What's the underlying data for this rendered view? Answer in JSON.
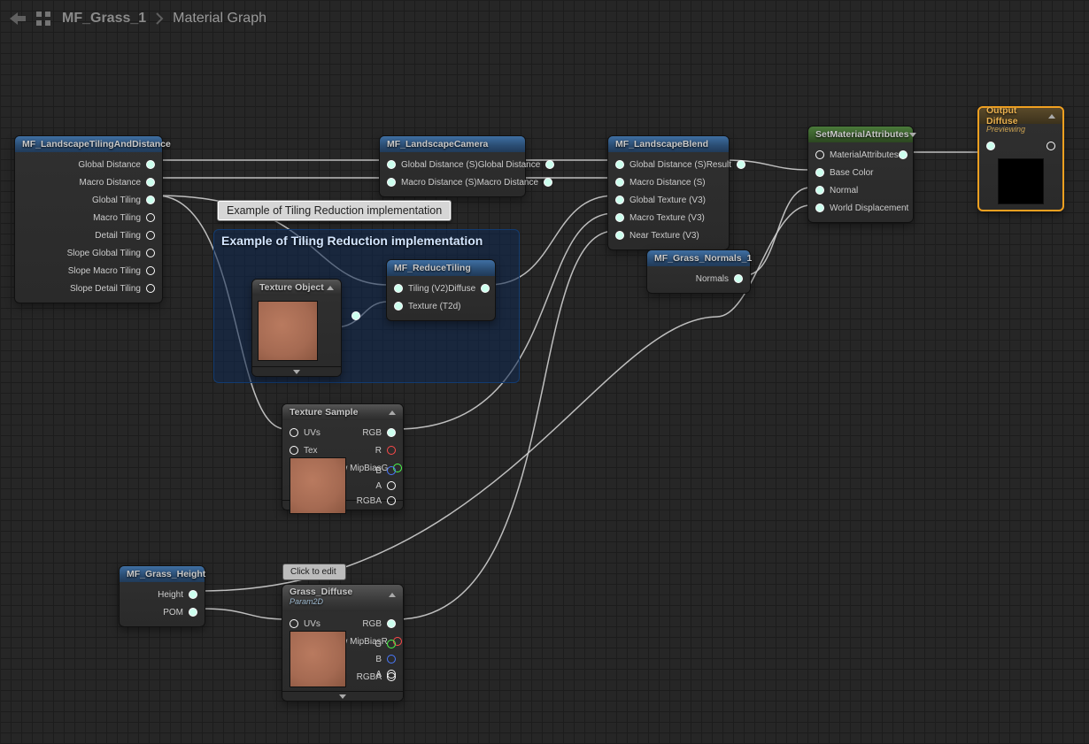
{
  "breadcrumb": {
    "asset": "MF_Grass_1",
    "page": "Material Graph"
  },
  "tooltip": "Example of Tiling Reduction implementation",
  "comment": {
    "title": "Example of Tiling Reduction implementation"
  },
  "clickToEdit": {
    "placeholder": "Click to edit"
  },
  "nodes": {
    "tilingDist": {
      "title": "MF_LandscapeTilingAndDistance",
      "outs": [
        "Global Distance",
        "Macro Distance",
        "Global Tiling",
        "Macro Tiling",
        "Detail Tiling",
        "Slope Global Tiling",
        "Slope Macro Tiling",
        "Slope Detail Tiling"
      ]
    },
    "camera": {
      "title": "MF_LandscapeCamera",
      "rows": [
        {
          "in": "Global Distance (S)",
          "out": "Global Distance"
        },
        {
          "in": "Macro Distance (S)",
          "out": "Macro Distance"
        }
      ]
    },
    "blend": {
      "title": "MF_LandscapeBlend",
      "ins": [
        "Global Distance (S)",
        "Macro Distance (S)",
        "Global Texture (V3)",
        "Macro Texture (V3)",
        "Near Texture (V3)"
      ],
      "outLabel": "Result"
    },
    "reduce": {
      "title": "MF_ReduceTiling",
      "ins": [
        "Tiling (V2)",
        "Texture (T2d)"
      ],
      "outLabel": "Diffuse"
    },
    "texObj": {
      "title": "Texture Object"
    },
    "texSample": {
      "title": "Texture Sample",
      "ins": [
        "UVs",
        "Tex",
        "Apply View MipBias"
      ],
      "outs": [
        "RGB",
        "R",
        "G",
        "B",
        "A",
        "RGBA"
      ]
    },
    "grassHeight": {
      "title": "MF_Grass_Height",
      "outs": [
        "Height",
        "POM"
      ]
    },
    "grassDiffuse": {
      "title": "Grass_Diffuse",
      "subtitle": "Param2D",
      "ins": [
        "UVs",
        "Apply View MipBias"
      ],
      "outs": [
        "RGB",
        "R",
        "G",
        "B",
        "A",
        "RGBA"
      ]
    },
    "grassNormals": {
      "title": "MF_Grass_Normals_1",
      "out": "Normals"
    },
    "setAttrs": {
      "title": "SetMaterialAttributes",
      "ddl": "chev",
      "ins": [
        "MaterialAttributes",
        "Base Color",
        "Normal",
        "World Displacement"
      ]
    },
    "output": {
      "title": "Output Diffuse",
      "sub": "Previewing"
    }
  },
  "colors": {
    "orange": "#f0a020",
    "blue": "#3f6fa3",
    "green": "#4a7a3a"
  }
}
